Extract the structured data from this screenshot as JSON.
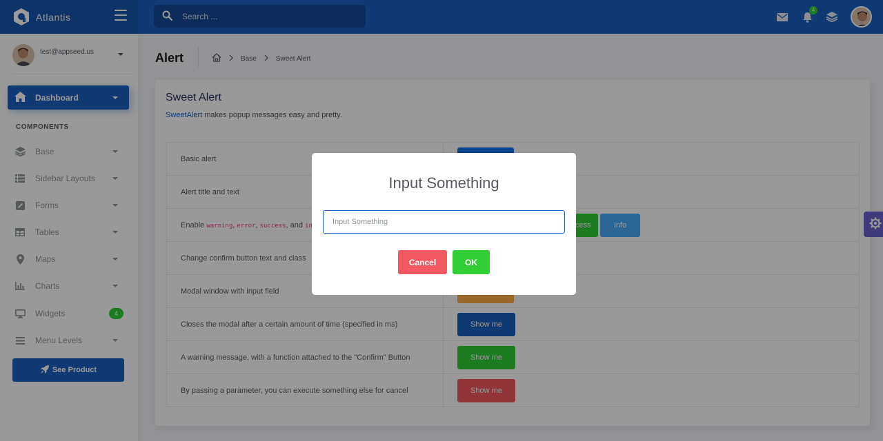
{
  "app": {
    "name": "Atlantis"
  },
  "search": {
    "placeholder": "Search ..."
  },
  "notifications": {
    "count": "4"
  },
  "user": {
    "email": "test@appseed.us"
  },
  "sidebar": {
    "dashboard_label": "Dashboard",
    "section_title": "COMPONENTS",
    "items": [
      {
        "label": "Base",
        "icon": "layers-icon"
      },
      {
        "label": "Sidebar Layouts",
        "icon": "list-icon"
      },
      {
        "label": "Forms",
        "icon": "pen-square-icon"
      },
      {
        "label": "Tables",
        "icon": "table-icon"
      },
      {
        "label": "Maps",
        "icon": "map-marker-icon"
      },
      {
        "label": "Charts",
        "icon": "chart-bar-icon"
      },
      {
        "label": "Widgets",
        "icon": "desktop-icon",
        "badge": "4"
      },
      {
        "label": "Menu Levels",
        "icon": "bars-icon"
      }
    ],
    "cta_label": "See Product"
  },
  "page": {
    "title": "Alert",
    "breadcrumb": [
      "Base",
      "Sweet Alert"
    ]
  },
  "card": {
    "title": "Sweet Alert",
    "link_text": "SweetAlert",
    "desc_rest": " makes popup messages easy and pretty."
  },
  "rows": [
    {
      "desc": "Basic alert"
    },
    {
      "desc": "Alert title and text"
    },
    {
      "desc_prefix": "Enable ",
      "codes": [
        "warning",
        "error",
        "success",
        "info"
      ],
      "sep1": ", ",
      "sep2": ", ",
      "sep3": ", and "
    },
    {
      "desc": "Change confirm button text and class"
    },
    {
      "desc": "Modal window with input field"
    },
    {
      "desc": "Closes the modal after a certain amount of time (specified in ms)",
      "btn": "Show me"
    },
    {
      "desc": "A warning message, with a function attached to the \"Confirm\" Button",
      "btn": "Show me"
    },
    {
      "desc": "By passing a parameter, you can execute something else for cancel",
      "btn": "Show me"
    }
  ],
  "row_buttons": {
    "success": "Success",
    "info": "Info"
  },
  "modal": {
    "title": "Input Something",
    "input_placeholder": "Input Something",
    "cancel_label": "Cancel",
    "ok_label": "OK"
  },
  "colors": {
    "primary": "#1a62c2",
    "success": "#31ce36",
    "danger": "#f25961",
    "warning": "#ffad46",
    "info": "#48abf7",
    "secondary": "#6861ce"
  }
}
